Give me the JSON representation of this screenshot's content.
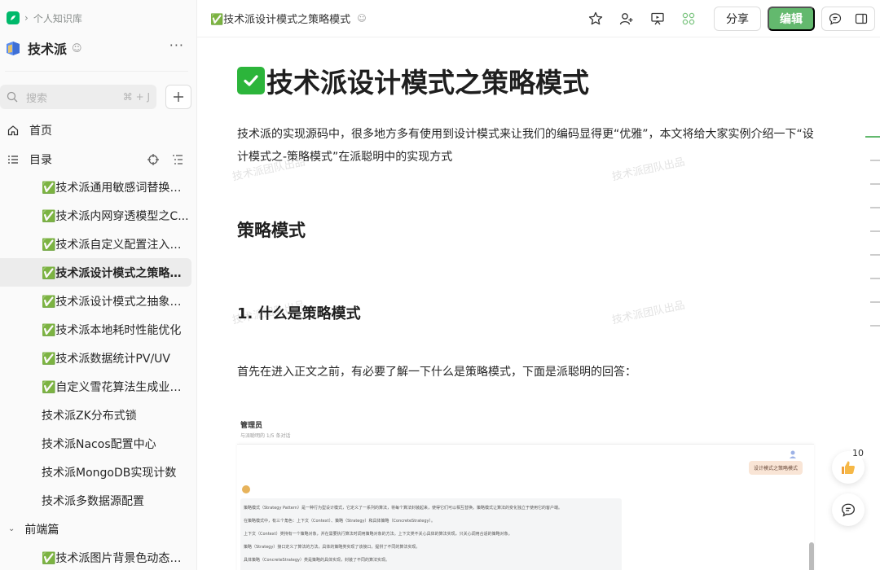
{
  "breadcrumb": {
    "label": "个人知识库"
  },
  "knowledge_base": {
    "title": "技术派",
    "more": "···"
  },
  "search": {
    "placeholder": "搜索",
    "shortcut": "⌘ + J"
  },
  "nav": {
    "home": "首页",
    "toc": "目录"
  },
  "tree": {
    "items": [
      {
        "label": "✅技术派通用敏感词替换（..."
      },
      {
        "label": "✅技术派内网穿透模型之C..."
      },
      {
        "label": "✅技术派自定义配置注入&..."
      },
      {
        "label": "✅技术派设计模式之策略模式",
        "active": true
      },
      {
        "label": "✅技术派设计模式之抽象设..."
      },
      {
        "label": "✅技术派本地耗时性能优化"
      },
      {
        "label": "✅技术派数据统计PV/UV"
      },
      {
        "label": "✅自定义雪花算法生成业务ID"
      },
      {
        "label": "技术派ZK分布式锁"
      },
      {
        "label": "技术派Nacos配置中心"
      },
      {
        "label": "技术派MongoDB实现计数"
      },
      {
        "label": "技术派多数据源配置"
      }
    ],
    "group": {
      "label": "前端篇"
    },
    "group_items": [
      {
        "label": "✅技术派图片背景色动态变更"
      }
    ]
  },
  "header": {
    "doc_tab": "✅技术派设计模式之策略模式",
    "share": "分享",
    "edit": "编辑"
  },
  "doc": {
    "title": "技术派设计模式之策略模式",
    "intro": "技术派的实现源码中，很多地方多有使用到设计模式来让我们的编码显得更“优雅”，本文将给大家实例介绍一下“设计模式之-策略模式”在派聪明中的实现方式",
    "h2": "策略模式",
    "h3": "1. 什么是策略模式",
    "para": "首先在进入正文之前，有必要了解一下什么是策略模式，下面是派聪明的回答：",
    "watermark": "技术派团队出品"
  },
  "embedded": {
    "title": "管理员",
    "subtitle": "与派聪明的 1/5 条对话",
    "user_bubble": "设计模式之策略模式",
    "answer_lines": [
      "策略模式（Strategy Pattern）是一种行为型设计模式，它定义了一系列的算法，将每个算法封装起来，使得它们可以相互替换。策略模式让算法的变化独立于使用它的客户端。",
      "在策略模式中，有三个角色：上下文（Context）、策略（Strategy）和具体策略（ConcreteStrategy）。",
      "上下文（Context）类持有一个策略对象，并在需要执行算法时调用策略对象的方法。上下文类不关心具体的算法实现，只关心调用合适的策略对象。",
      "策略（Strategy）接口定义了算法的方法，具体的策略类实现了该接口，提供了不同的算法实现。",
      "具体策略（ConcreteStrategy）类是策略的具体实现，封装了不同的算法实现。"
    ]
  },
  "floating": {
    "like_count": "10"
  }
}
